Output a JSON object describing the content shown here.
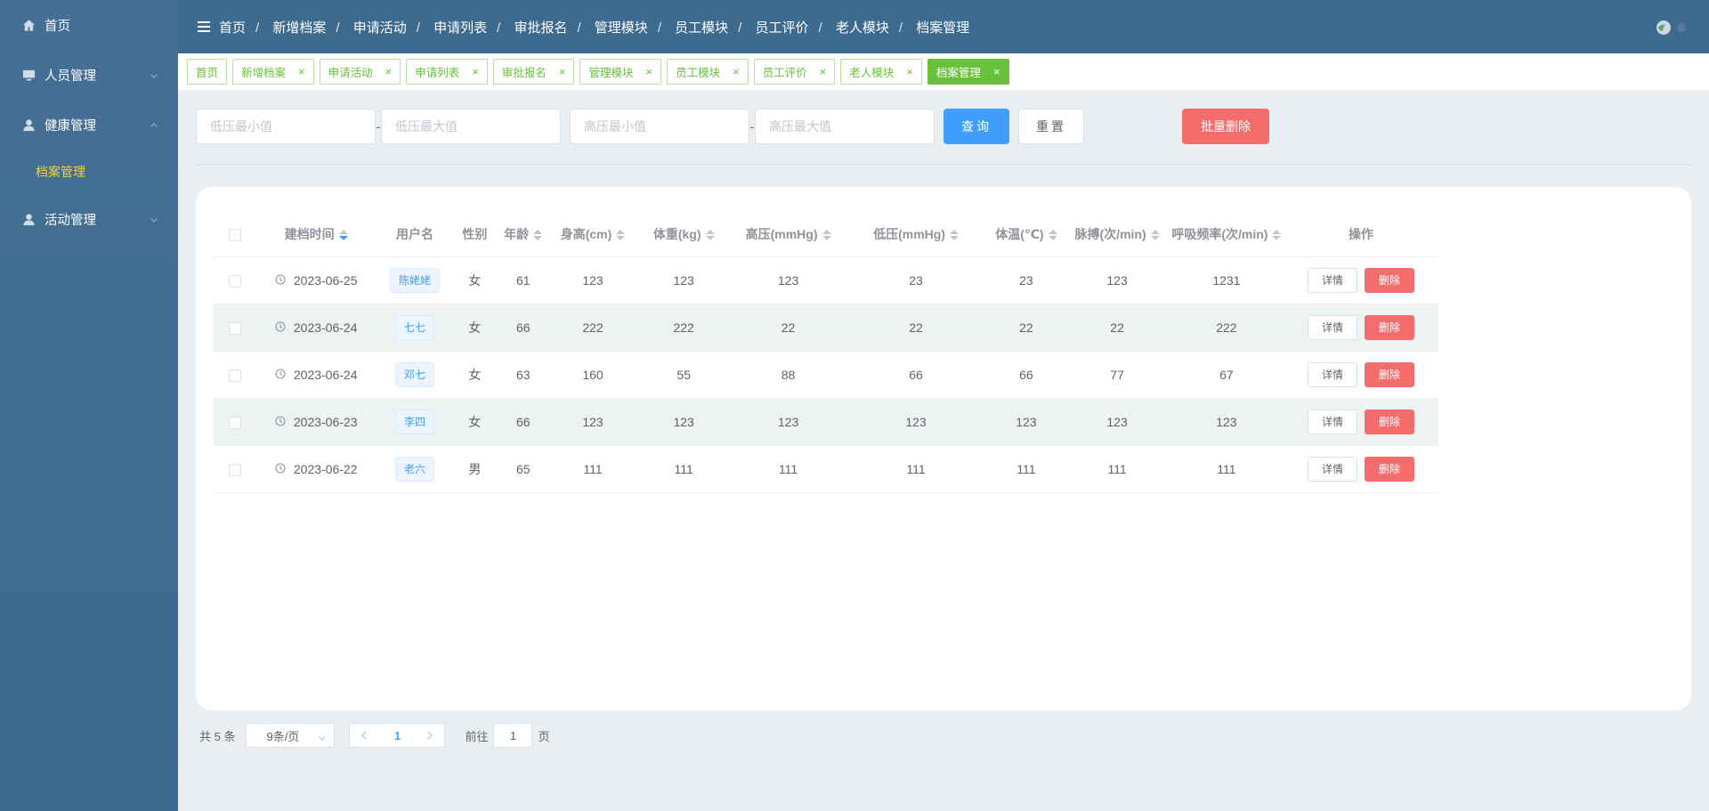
{
  "sidebar": {
    "items": [
      {
        "label": "首页",
        "icon": "home-icon"
      },
      {
        "label": "人员管理",
        "icon": "monitor-icon"
      },
      {
        "label": "健康管理",
        "icon": "user-icon"
      },
      {
        "label": "档案管理"
      },
      {
        "label": "活动管理",
        "icon": "user-icon"
      }
    ]
  },
  "breadcrumb": [
    "首页",
    "新增档案",
    "申请活动",
    "申请列表",
    "审批报名",
    "管理模块",
    "员工模块",
    "员工评价",
    "老人模块",
    "档案管理"
  ],
  "tabs": [
    {
      "label": "首页"
    },
    {
      "label": "新增档案"
    },
    {
      "label": "申请活动"
    },
    {
      "label": "申请列表"
    },
    {
      "label": "审批报名"
    },
    {
      "label": "管理模块"
    },
    {
      "label": "员工模块"
    },
    {
      "label": "员工评价"
    },
    {
      "label": "老人模块"
    },
    {
      "label": "档案管理",
      "active": true
    }
  ],
  "tab_close_glyph": "×",
  "search": {
    "low_min_placeholder": "低压最小值",
    "low_max_placeholder": "低压最大值",
    "high_min_placeholder": "高压最小值",
    "high_max_placeholder": "高压最大值",
    "separator": "-",
    "query_label": "查询",
    "reset_label": "重置",
    "batch_delete_label": "批量删除"
  },
  "table": {
    "headers": [
      "建档时间",
      "用户名",
      "性别",
      "年龄",
      "身高(cm)",
      "体重(kg)",
      "高压(mmHg)",
      "低压(mmHg)",
      "体温(℃)",
      "脉搏(次/min)",
      "呼吸频率(次/min)",
      "操作"
    ],
    "detail_label": "详情",
    "delete_label": "删除",
    "rows": [
      {
        "date": "2023-06-25",
        "user": "陈姥姥",
        "gender": "女",
        "age": "61",
        "height": "123",
        "weight": "123",
        "high": "123",
        "low": "23",
        "temp": "23",
        "pulse": "123",
        "resp": "1231"
      },
      {
        "date": "2023-06-24",
        "user": "七七",
        "gender": "女",
        "age": "66",
        "height": "222",
        "weight": "222",
        "high": "22",
        "low": "22",
        "temp": "22",
        "pulse": "22",
        "resp": "222"
      },
      {
        "date": "2023-06-24",
        "user": "邓七",
        "gender": "女",
        "age": "63",
        "height": "160",
        "weight": "55",
        "high": "88",
        "low": "66",
        "temp": "66",
        "pulse": "77",
        "resp": "67"
      },
      {
        "date": "2023-06-23",
        "user": "李四",
        "gender": "女",
        "age": "66",
        "height": "123",
        "weight": "123",
        "high": "123",
        "low": "123",
        "temp": "123",
        "pulse": "123",
        "resp": "123"
      },
      {
        "date": "2023-06-22",
        "user": "老六",
        "gender": "男",
        "age": "65",
        "height": "111",
        "weight": "111",
        "high": "111",
        "low": "111",
        "temp": "111",
        "pulse": "111",
        "resp": "111"
      }
    ]
  },
  "pagination": {
    "total_text": "共 5 条",
    "page_size": "9条/页",
    "current_page": "1",
    "goto_prefix": "前往",
    "goto_value": "1",
    "goto_suffix": "页"
  },
  "colors": {
    "sidebar": "#3d6a8f",
    "active_submenu": "#f5d13a",
    "tab_green": "#67c23a",
    "primary": "#409eff",
    "danger": "#f56c6c"
  }
}
